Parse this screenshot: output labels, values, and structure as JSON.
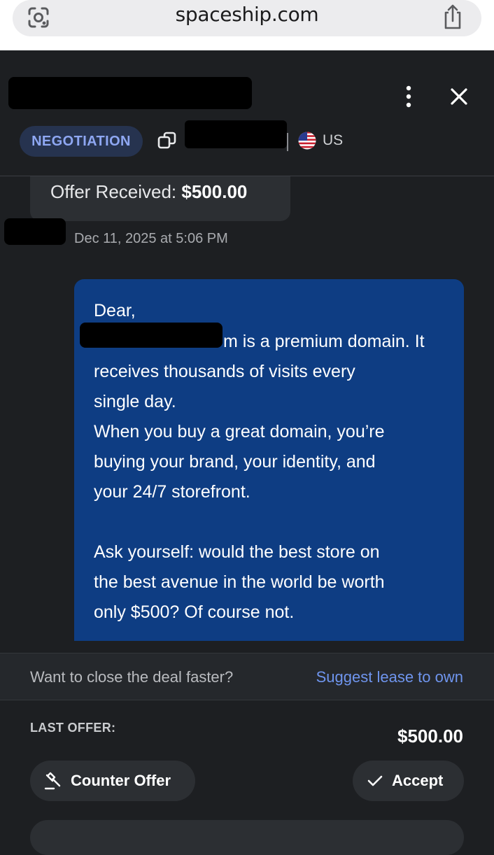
{
  "browser": {
    "url": "spaceship.com"
  },
  "header": {
    "status_badge": "NEGOTIATION",
    "country": "US"
  },
  "offer": {
    "label": "Offer Received: ",
    "amount": "$500.00",
    "timestamp": "Dec 11, 2025 at 5:06 PM"
  },
  "message": {
    "lines": [
      "Dear,",
      "m is a premium domain. It",
      "receives thousands of visits every",
      "single day.",
      "When you buy a great domain, you’re",
      "buying your brand, your identity, and",
      "your 24/7 storefront.",
      "Ask yourself: would the best store on",
      "the best avenue in the world be worth",
      "only $500? Of course not."
    ]
  },
  "lease": {
    "question": "Want to close the deal faster?",
    "link": "Suggest lease to own"
  },
  "footer": {
    "last_offer_label": "LAST OFFER:",
    "last_offer_value": "$500.00",
    "counter_label": "Counter Offer",
    "accept_label": "Accept"
  },
  "colors": {
    "background": "#1d1f22",
    "message_bubble": "#0e3d83",
    "badge_bg": "#26334f",
    "badge_text": "#8ea7f2",
    "link": "#6f95ee"
  },
  "icons": [
    "google-lens-icon",
    "share-icon",
    "more-vertical-icon",
    "close-icon",
    "copy-icon",
    "us-flag-icon",
    "gavel-icon",
    "checkmark-icon"
  ]
}
